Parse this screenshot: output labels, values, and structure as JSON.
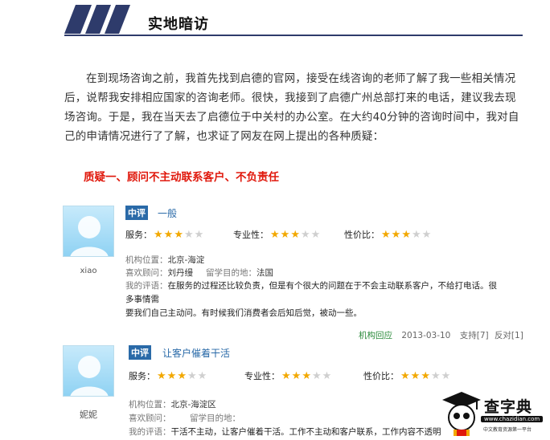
{
  "section": {
    "title": "实地暗访"
  },
  "intro": "在到现场咨询之前，我首先找到启德的官网，接受在线咨询的老师了解了我一些相关情况后，说帮我安排相应国家的咨询老师。很快，我接到了启德广州总部打来的电话，建议我去现场咨询。于是，我在当天去了启德位于中关村的办公室。在大约40分钟的咨询时间中，我对自己的申请情况进行了了解，也求证了网友在网上提出的各种质疑：",
  "doubt_title": "质疑一、顾问不主动联系客户、不负责任",
  "reviews": [
    {
      "rating_label": "中评",
      "title": "一般",
      "username": "xiao",
      "service_label": "服务：",
      "service_stars": 3,
      "professional_label": "专业性：",
      "professional_stars": 3,
      "value_label": "性价比：",
      "value_stars": 3,
      "location_label": "机构位置：",
      "location": "北京-海淀",
      "consultant_label": "喜欢顾问：",
      "consultant": "刘丹缦",
      "destination_label": "留学目的地：",
      "destination": "法国",
      "comment_label": "我的评语：",
      "comment_line1": "在服务的过程还比较负责，但是有个很大的问题在于不会主动联系客户，不给打电话。很多事情需",
      "comment_line2": "要我们自己主动问。有时候我们消费者会后知后觉，被动一些。",
      "footer_reply": "机构回应",
      "footer_date": "2013-03-10",
      "footer_support": "支持[7]",
      "footer_oppose": "反对[1]"
    },
    {
      "rating_label": "中评",
      "title": "让客户催着干活",
      "username": "妮妮",
      "service_label": "服务：",
      "service_stars": 3,
      "professional_label": "专业性：",
      "professional_stars": 3,
      "value_label": "性价比：",
      "value_stars": 3,
      "location_label": "机构位置：",
      "location": "北京-海淀区",
      "consultant_label": "喜欢顾问：",
      "consultant": "",
      "destination_label": "留学目的地：",
      "destination": "",
      "comment_label": "我的评语：",
      "comment_line1": "干活不主动，让客户催着干活。工作不主动和客户联系，工作内容不透明"
    }
  ],
  "logo": {
    "name": "查字典",
    "url": "www.chazidian.com",
    "tagline": "中文教育资源第一平台"
  },
  "colors": {
    "accent_blue": "#2a6aa8",
    "header_navy": "#2e3b6b",
    "alert_red": "#e0180c",
    "star_gold": "#f2a800"
  }
}
